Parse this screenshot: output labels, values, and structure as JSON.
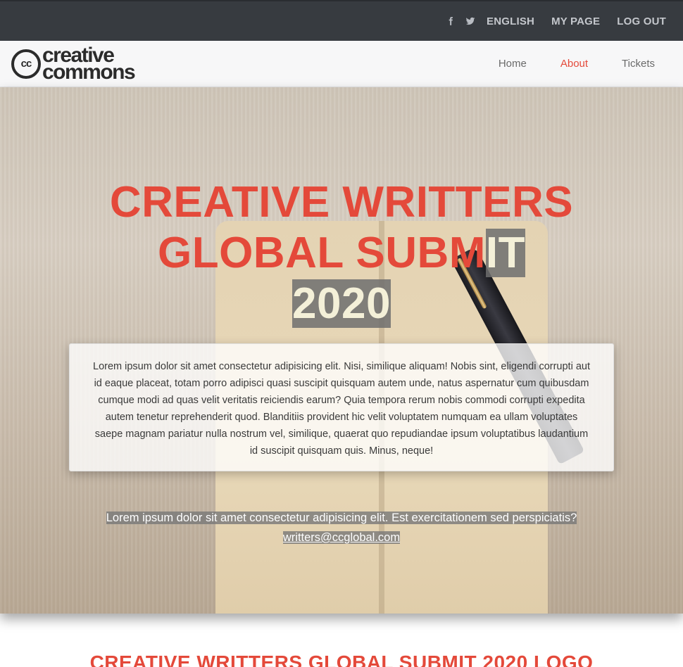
{
  "topbar": {
    "icons": [
      "facebook-icon",
      "twitter-icon"
    ],
    "links": [
      "ENGLISH",
      "MY PAGE",
      "LOG OUT"
    ]
  },
  "nav": {
    "logo_line1": "creative",
    "logo_line2": "commons",
    "logo_badge": "cc",
    "items": [
      {
        "label": "Home",
        "active": false
      },
      {
        "label": "About",
        "active": true
      },
      {
        "label": "Tickets",
        "active": false
      }
    ]
  },
  "hero": {
    "title_line1": "CREATIVE WRITTERS",
    "title_line2a": "GLOBAL SUBM",
    "title_line2b": "IT",
    "title_line3": "2020",
    "description": "Lorem ipsum dolor sit amet consectetur adipisicing elit. Nisi, similique aliquam! Nobis sint, eligendi corrupti aut id eaque placeat, totam porro adipisci quasi suscipit quisquam autem unde, natus aspernatur cum quibusdam cumque modi ad quas velit veritatis reiciendis earum? Quia tempora rerum nobis commodi corrupti expedita autem tenetur reprehenderit quod. Blanditiis provident hic velit voluptatem numquam ea ullam voluptates saepe magnam pariatur nulla nostrum vel, similique, quaerat quo repudiandae ipsum voluptatibus laudantium id suscipit quisquam quis. Minus, neque!",
    "contact_text": "Lorem ipsum dolor sit amet consectetur adipisicing elit. Est exercitationem sed perspiciatis?",
    "email": "writters@ccglobal.com"
  },
  "section": {
    "title": "CREATIVE WRITTERS GLOBAL SUBMIT 2020 LOGO"
  },
  "colors": {
    "accent": "#e4493a",
    "topbar": "#373b40",
    "navbar": "#f7f7f8"
  }
}
